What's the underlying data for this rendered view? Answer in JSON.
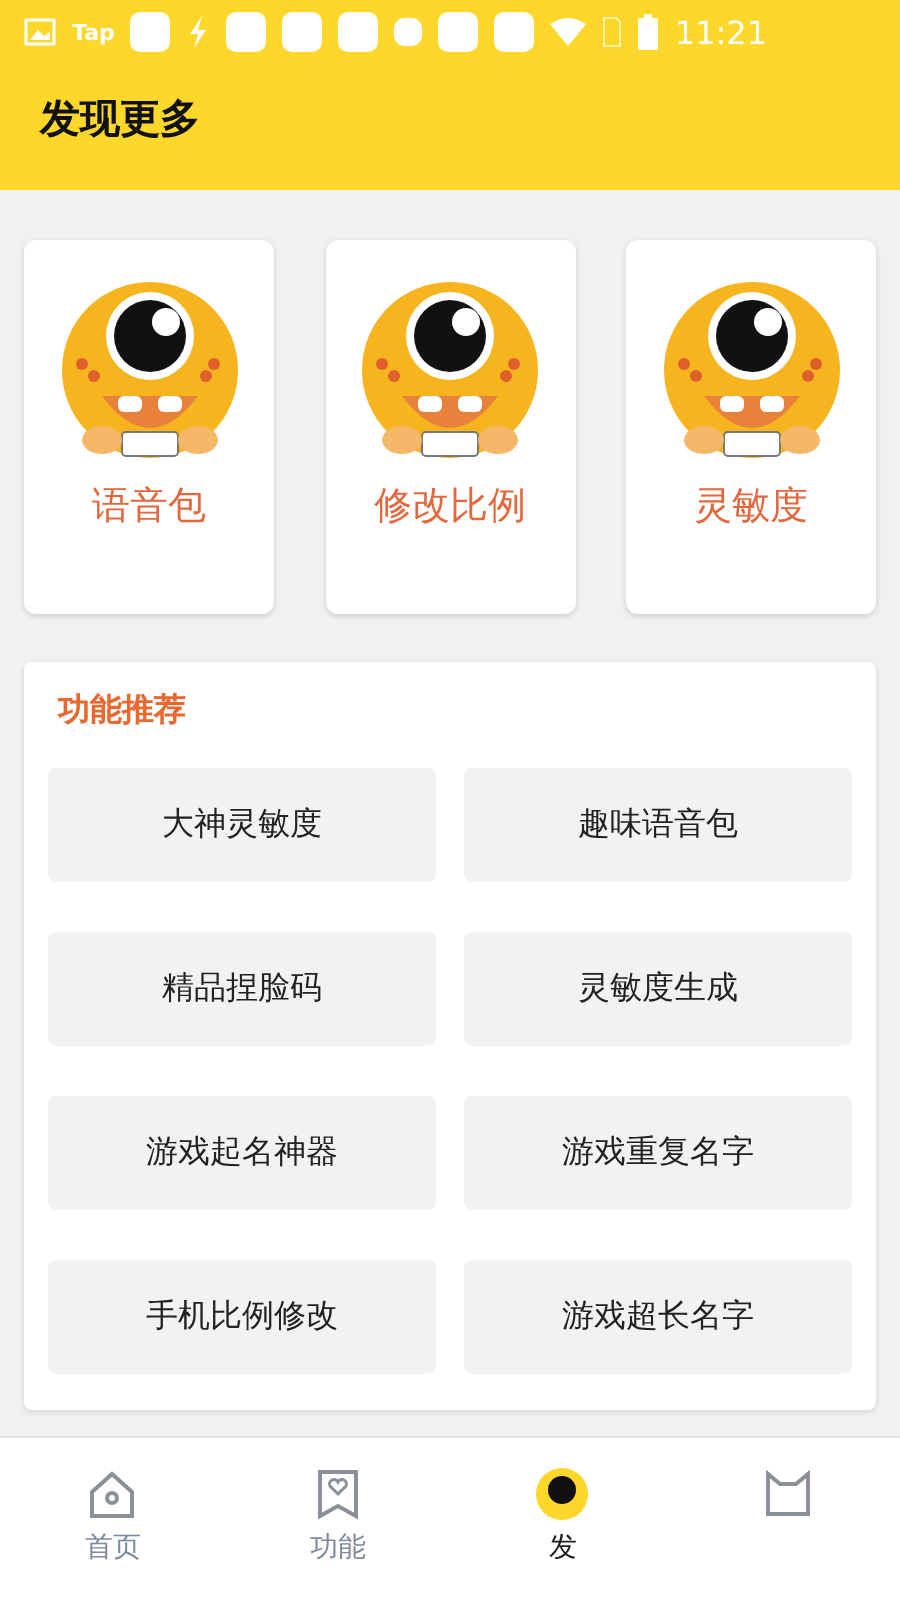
{
  "status_bar": {
    "app_label": "Tap",
    "time": "11:21"
  },
  "header": {
    "title": "发现更多"
  },
  "feature_cards": [
    {
      "label": "语音包"
    },
    {
      "label": "修改比例"
    },
    {
      "label": "灵敏度"
    }
  ],
  "recommend": {
    "title": "功能推荐",
    "items": [
      "大神灵敏度",
      "趣味语音包",
      "精品捏脸码",
      "灵敏度生成",
      "游戏起名神器",
      "游戏重复名字",
      "手机比例修改",
      "游戏超长名字"
    ]
  },
  "nav": [
    {
      "kind": "home",
      "label": "首页",
      "selected": false
    },
    {
      "kind": "feature",
      "label": "功能",
      "selected": false
    },
    {
      "kind": "discover",
      "label": "发",
      "selected": true
    },
    {
      "kind": "cat",
      "selected": false
    }
  ]
}
